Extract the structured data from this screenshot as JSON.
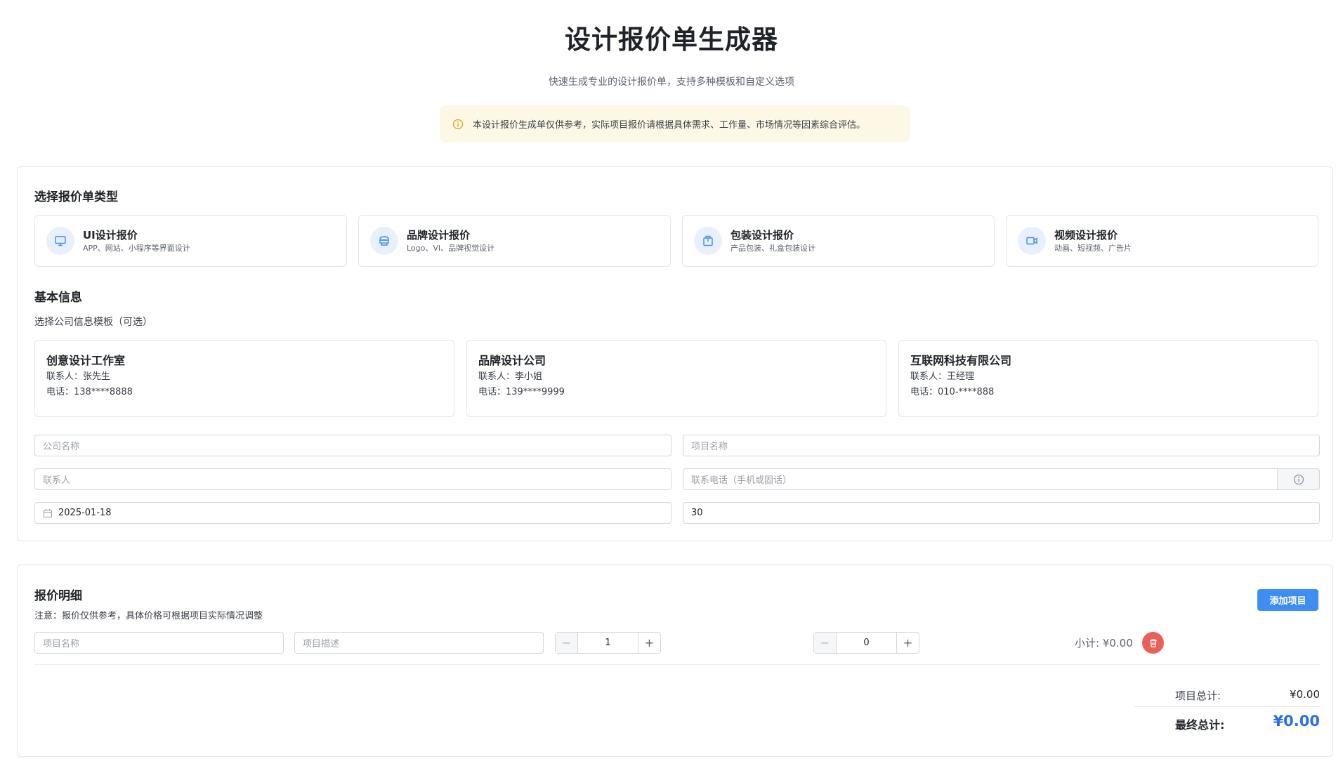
{
  "header": {
    "title": "设计报价单生成器",
    "subtitle": "快速生成专业的设计报价单，支持多种模板和自定义选项",
    "notice": "本设计报价生成单仅供参考，实际项目报价请根据具体需求、工作量、市场情况等因素综合评估。"
  },
  "type_section": {
    "title": "选择报价单类型",
    "types": [
      {
        "title": "UI设计报价",
        "desc": "APP、网站、小程序等界面设计",
        "icon": "monitor-icon"
      },
      {
        "title": "品牌设计报价",
        "desc": "Logo、VI、品牌视觉设计",
        "icon": "brand-icon"
      },
      {
        "title": "包装设计报价",
        "desc": "产品包装、礼盒包装设计",
        "icon": "package-icon"
      },
      {
        "title": "视频设计报价",
        "desc": "动画、短视频、广告片",
        "icon": "video-icon"
      }
    ]
  },
  "basic_info": {
    "title": "基本信息",
    "template_label": "选择公司信息模板（可选）",
    "templates": [
      {
        "name": "创意设计工作室",
        "contact": "联系人：张先生",
        "phone": "电话：138****8888"
      },
      {
        "name": "品牌设计公司",
        "contact": "联系人：李小姐",
        "phone": "电话：139****9999"
      },
      {
        "name": "互联网科技有限公司",
        "contact": "联系人：王经理",
        "phone": "电话：010-****888"
      }
    ],
    "fields": {
      "company_placeholder": "公司名称",
      "project_placeholder": "项目名称",
      "contact_placeholder": "联系人",
      "phone_placeholder": "联系电话（手机或固话）",
      "date_value": "2025-01-18",
      "days_value": "30"
    }
  },
  "quote": {
    "title": "报价明细",
    "note": "注意：报价仅供参考，具体价格可根据项目实际情况调整",
    "add_button": "添加项目",
    "item": {
      "name_placeholder": "项目名称",
      "desc_placeholder": "项目描述",
      "quantity": "1",
      "price": "0",
      "subtotal": "小计: ¥0.00"
    },
    "summary": {
      "items_total_label": "项目总计:",
      "items_total_value": "¥0.00",
      "final_total_label": "最终总计:",
      "final_total_value": "¥0.00"
    }
  },
  "colors": {
    "accent": "#3d8ef0",
    "danger": "#e9605a",
    "notice_bg": "#fdf8e6",
    "total": "#2b6fe6"
  }
}
